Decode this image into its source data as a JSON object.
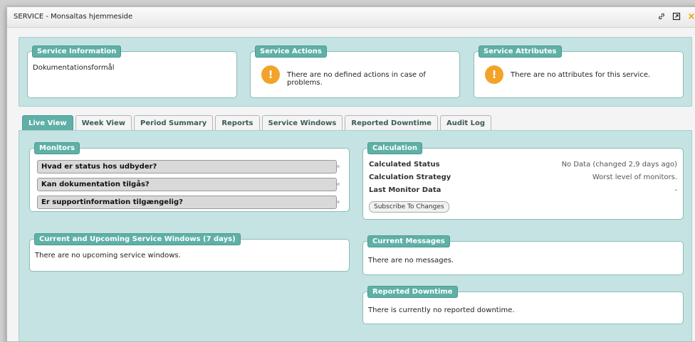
{
  "window": {
    "title": "SERVICE - Monsaltas hjemmeside"
  },
  "service_info": {
    "legend": "Service Information",
    "text": "Dokumentationsformål"
  },
  "service_actions": {
    "legend": "Service Actions",
    "text": "There are no defined actions in case of problems."
  },
  "service_attributes": {
    "legend": "Service Attributes",
    "text": "There are no attributes for this service."
  },
  "tabs": [
    "Live View",
    "Week View",
    "Period Summary",
    "Reports",
    "Service Windows",
    "Reported Downtime",
    "Audit Log"
  ],
  "active_tab": "Live View",
  "monitors": {
    "legend": "Monitors",
    "items": [
      "Hvad er status hos udbyder?",
      "Kan dokumentation tilgås?",
      "Er supportinformation tilgængelig?"
    ]
  },
  "calculation": {
    "legend": "Calculation",
    "rows": [
      {
        "label": "Calculated Status",
        "value": "No Data (changed 2,9 days ago)"
      },
      {
        "label": "Calculation Strategy",
        "value": "Worst level of monitors."
      },
      {
        "label": "Last Monitor Data",
        "value": "-"
      }
    ],
    "subscribe_label": "Subscribe To Changes"
  },
  "service_windows": {
    "legend": "Current and Upcoming Service Windows (7 days)",
    "text": "There are no upcoming service windows."
  },
  "messages": {
    "legend": "Current Messages",
    "text": "There are no messages."
  },
  "downtime": {
    "legend": "Reported Downtime",
    "text": "There is currently no reported downtime."
  },
  "icons": {
    "link": "link-icon",
    "popout": "popout-icon",
    "close": "close-icon",
    "warning": "warning-icon"
  }
}
